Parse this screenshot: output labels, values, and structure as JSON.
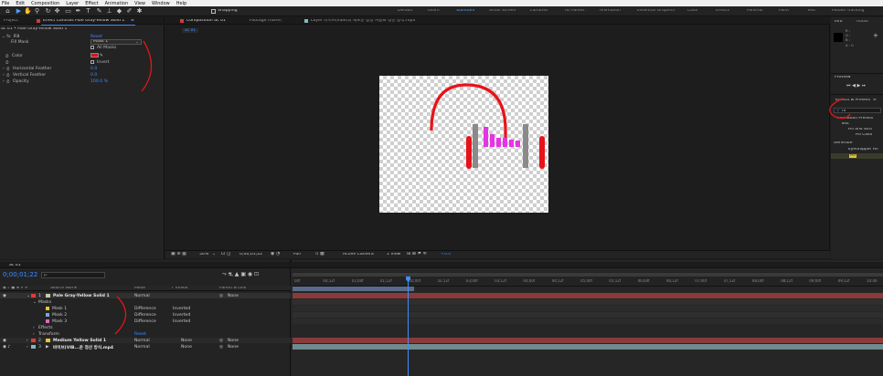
{
  "menubar": [
    "File",
    "Edit",
    "Composition",
    "Layer",
    "Effect",
    "Animation",
    "View",
    "Window",
    "Help"
  ],
  "toolbar": {
    "snapping_label": "Snapping",
    "workspaces": [
      "Default",
      "Learn",
      "Standard",
      "Small Screen",
      "Libraries",
      "All Panels",
      "Animation",
      "Essential Graphics",
      "Color",
      "Effects",
      "Minimal",
      "Paint",
      "Text",
      "Motion Tracking"
    ],
    "active_workspace": "Standard"
  },
  "effect_controls": {
    "project_tab": "Project",
    "tab_label": "Effect Controls Pale Gray-Yellow Solid 1",
    "layer_path": "ac 01 • Pale Gray-Yellow Solid 1",
    "effect_name": "Fill",
    "reset_label": "Reset",
    "rows": [
      {
        "label": "Fill Mask",
        "value": "Mask 1"
      },
      {
        "label": "",
        "value": "All Masks"
      },
      {
        "label": "Color",
        "value": ""
      },
      {
        "label": "",
        "value": "Invert"
      },
      {
        "label": "Horizontal Feather",
        "value": "0.0"
      },
      {
        "label": "Vertical Feather",
        "value": "0.0"
      },
      {
        "label": "Opacity",
        "value": "100.0 %"
      }
    ],
    "fill_color": "#e0101a"
  },
  "composition": {
    "tab_label": "Composition ac 01",
    "footage_tab": "Footage (none)",
    "layer_tab": "Layer 바이브(vibe)의 세로운 등장 사용료 정산 방식.mp4",
    "comp_crumb": "ac 01",
    "footer": {
      "zoom": "50%",
      "timecode": "0;00;01;22",
      "quality": "Full",
      "camera": "Active Camera",
      "view": "1 View",
      "exposure": "+0.0"
    }
  },
  "right_panel": {
    "info_tab": "Info",
    "audio_tab": "Audio",
    "info_values": [
      "R :",
      "G :",
      "B :",
      "A : 0"
    ],
    "preview_tab": "Preview",
    "effects_presets_tab": "Effects & Presets",
    "search_value": "fil",
    "tree": [
      "* Animation Presets",
      "Text",
      "Fill and Stro",
      "Fill Color",
      "Generate",
      "Eyedropper Fill",
      "Fill"
    ]
  },
  "timeline": {
    "comp_tab": "ac 01",
    "timecode": "0;00;01;22",
    "search_placeholder": "ρ.",
    "headers": {
      "source": "Source Name",
      "mode": "Mode",
      "trkmat": "T  TrkMat",
      "parent": "Parent & Link"
    },
    "layers": [
      {
        "num": "1",
        "name": "Pale Gray-Yellow Solid 1",
        "mode": "Normal",
        "parent": "None",
        "color": "#c9c9a8"
      },
      {
        "num": "2",
        "name": "Medium Yellow Solid 1",
        "mode": "Normal",
        "trkmat": "None",
        "parent": "None",
        "color": "#e8c530"
      },
      {
        "num": "3",
        "name": "바이브(VIB...운 정산 방식.mp4",
        "mode": "Normal",
        "trkmat": "None",
        "parent": "None",
        "color": "#86b6c0"
      }
    ],
    "masks_label": "Masks",
    "masks": [
      {
        "name": "Mask 1",
        "mode": "Difference",
        "inv": "Inverted",
        "color": "#e8c530"
      },
      {
        "name": "Mask 2",
        "mode": "Difference",
        "inv": "Inverted",
        "color": "#7fa0d8"
      },
      {
        "name": "Mask 3",
        "mode": "Difference",
        "inv": "Inverted",
        "color": "#d86fb0"
      }
    ],
    "effects_label": "Effects",
    "transform_label": "Transform",
    "reset_label": "Reset",
    "ruler": [
      "00f",
      "00;12f",
      "01;00f",
      "01;12f",
      "02;00f",
      "02;12f",
      "03;00f",
      "03;12f",
      "04;00f",
      "04;12f",
      "05;00f",
      "05;12f",
      "06;00f",
      "06;12f",
      "07;00f",
      "07;12f",
      "08;00f",
      "08;12f",
      "09;00f",
      "09;12f",
      "10:00"
    ]
  }
}
